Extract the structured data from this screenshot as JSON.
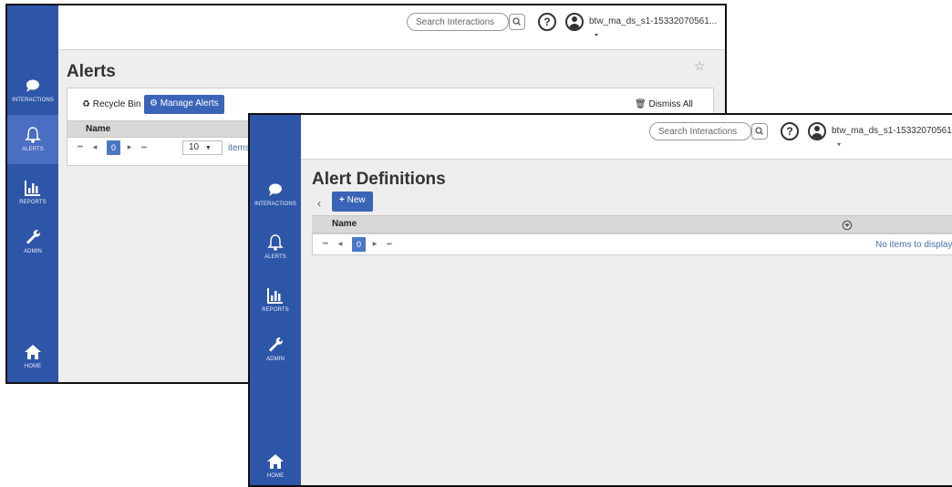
{
  "nav_items": {
    "interactions": "INTERACTIONS",
    "alerts": "ALERTS",
    "reports": "REPORTS",
    "admin": "ADMIN",
    "home": "HOME"
  },
  "topbar": {
    "search_placeholder": "Search Interactions",
    "help_label": "?",
    "user_name": "btw_ma_ds_s1-15332070561..."
  },
  "alerts_window": {
    "title": "Alerts",
    "recycle_bin_label": "Recycle Bin",
    "manage_alerts_label": "Manage Alerts",
    "dismiss_all_label": "Dismiss All",
    "column_name": "Name",
    "current_page": "0",
    "page_size": "10",
    "items_per_page": "items pe"
  },
  "definitions_window": {
    "title": "Alert Definitions",
    "back_label": "‹",
    "new_button_label": "New",
    "column_name": "Name",
    "current_page": "0",
    "empty_message": "No items to display"
  },
  "pager": {
    "first": "⏮",
    "prev": "◀",
    "next": "▶",
    "last": "⏭"
  },
  "colors": {
    "sidebar": "#2e56a8",
    "sidebar_active": "#4a6ec2",
    "accent": "#3a64b8"
  }
}
